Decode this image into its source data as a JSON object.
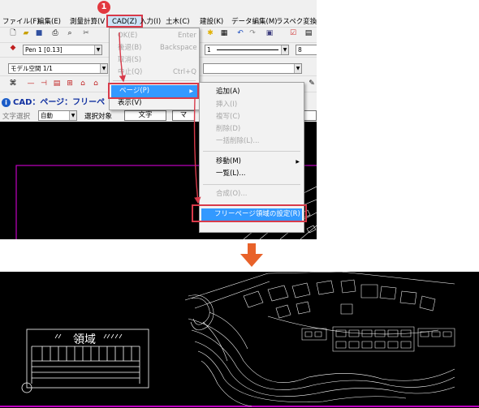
{
  "step_badge": "1",
  "menubar": [
    {
      "label": "ファイル(F)"
    },
    {
      "label": "編集(E)"
    },
    {
      "label": "測量計算(V"
    },
    {
      "label": "CAD(Z)"
    },
    {
      "label": "入力(I)"
    },
    {
      "label": "土木(C)"
    },
    {
      "label": "建設(K)"
    },
    {
      "label": "データ編集(M)"
    },
    {
      "label": "ラスペク変換(B"
    }
  ],
  "toolbar": {
    "pen_combo": "Pen 1 [0.13]",
    "line_combo": "1",
    "number_combo": "8",
    "space_combo": "モデル空間 1/1"
  },
  "caption": "CAD：ページ：フリーペ",
  "selection_bar": {
    "mode_label": "文字選択",
    "mode_value": "自動",
    "target_label": "選択対象",
    "text_button": "文字",
    "mark_button": "マ"
  },
  "cad_menu": {
    "items": [
      {
        "label": "OK(E)",
        "shortcut": "Enter",
        "disabled": true
      },
      {
        "label": "後退(B)",
        "shortcut": "Backspace",
        "disabled": true
      },
      {
        "label": "取消(S)",
        "shortcut": "",
        "disabled": true
      },
      {
        "label": "中止(Q)",
        "shortcut": "Ctrl+Q",
        "disabled": true
      },
      {
        "label": "ページ(P)",
        "shortcut": "",
        "disabled": false,
        "highlight": true
      },
      {
        "label": "表示(V)",
        "shortcut": "",
        "disabled": false
      }
    ]
  },
  "page_menu": {
    "items": [
      {
        "label": "追加(A)",
        "disabled": false
      },
      {
        "label": "挿入(I)",
        "disabled": true
      },
      {
        "label": "複写(C)",
        "disabled": true
      },
      {
        "label": "削除(D)",
        "disabled": true
      },
      {
        "label": "一括削除(L)...",
        "disabled": true
      },
      {
        "label": "移動(M)",
        "disabled": false,
        "submenu": true
      },
      {
        "label": "一覧(L)...",
        "disabled": false
      },
      {
        "label": "合成(O)...",
        "disabled": true
      },
      {
        "label": "フリーページ領域の設定(R)",
        "disabled": false,
        "highlight": true
      }
    ]
  },
  "bottom": {
    "region_label": "領域"
  },
  "colors": {
    "callout_red": "#d83a4a",
    "arrow_orange": "#e8622a",
    "menu_highlight": "#3399ff",
    "frame_magenta": "#c000c0"
  }
}
